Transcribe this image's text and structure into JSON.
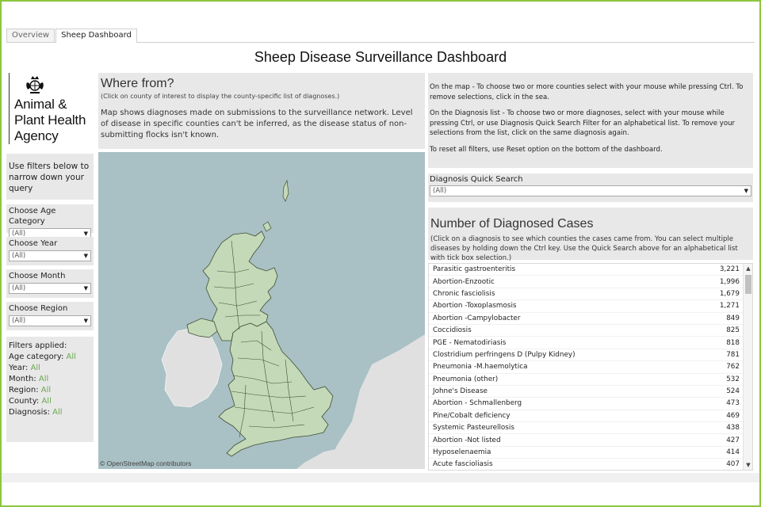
{
  "tabs": [
    {
      "label": "Overview",
      "active": false
    },
    {
      "label": "Sheep Dashboard",
      "active": true
    }
  ],
  "dashboard_title": "Sheep Disease Surveillance Dashboard",
  "agency": {
    "name": "Animal &\nPlant Health\nAgency",
    "crest_icon": "royal-crest-icon"
  },
  "filters_intro": "Use filters below to narrow down your query",
  "filters": [
    {
      "label": "Choose Age Category",
      "value": "(All)"
    },
    {
      "label": "Choose Year",
      "value": "(All)"
    },
    {
      "label": "Choose Month",
      "value": "(All)"
    },
    {
      "label": "Choose Region",
      "value": "(All)"
    }
  ],
  "applied": {
    "heading": "Filters applied:",
    "items": [
      {
        "label": "Age category:",
        "value": "All"
      },
      {
        "label": "Year:",
        "value": "All"
      },
      {
        "label": "Month:",
        "value": "All"
      },
      {
        "label": "Region:",
        "value": "All"
      },
      {
        "label": "County:",
        "value": "All"
      },
      {
        "label": "Diagnosis:",
        "value": "All"
      }
    ]
  },
  "where": {
    "title": "Where from?",
    "subtitle": "(Click on county of interest to display the county-specific list of diagnoses.)",
    "description": "Map shows diagnoses made on submissions to the surveillance network. Level of disease in specific counties can't be inferred, as the disease status of non-submitting flocks isn't known."
  },
  "map": {
    "attribution": "© OpenStreetMap contributors"
  },
  "instructions": [
    "On the map - To choose two or more counties select with your mouse while pressing Ctrl. To remove selections, click in the sea.",
    "On the Diagnosis list - To choose two or more diagnoses, select with your mouse while pressing Ctrl, or use Diagnosis Quick Search Filter for an alphabetical list. To remove your selections from the list, click on the same diagnosis again.",
    "To reset all filters, use Reset option on the bottom of the dashboard."
  ],
  "quick_search": {
    "label": "Diagnosis Quick Search",
    "value": "(All)"
  },
  "cases": {
    "title": "Number of Diagnosed Cases",
    "subtitle": "(Click on a diagnosis to see which counties the cases came from. You can select multiple diseases by holding down the Ctrl key. Use the Quick Search above for an alphabetical list with tick box selection.)",
    "rows": [
      {
        "name": "Parasitic gastroenteritis",
        "count": "3,221"
      },
      {
        "name": "Abortion-Enzootic",
        "count": "1,996"
      },
      {
        "name": "Chronic fasciolisis",
        "count": "1,679"
      },
      {
        "name": "Abortion -Toxoplasmosis",
        "count": "1,271"
      },
      {
        "name": "Abortion -Campylobacter",
        "count": "849"
      },
      {
        "name": "Coccidiosis",
        "count": "825"
      },
      {
        "name": "PGE - Nematodiriasis",
        "count": "818"
      },
      {
        "name": "Clostridium perfringens D (Pulpy Kidney)",
        "count": "781"
      },
      {
        "name": "Pneumonia -M.haemolytica",
        "count": "762"
      },
      {
        "name": "Pneumonia (other)",
        "count": "532"
      },
      {
        "name": "Johne's Disease",
        "count": "524"
      },
      {
        "name": "Abortion - Schmallenberg",
        "count": "473"
      },
      {
        "name": "Pine/Cobalt deficiency",
        "count": "469"
      },
      {
        "name": "Systemic Pasteurellosis",
        "count": "438"
      },
      {
        "name": "Abortion -Not listed",
        "count": "427"
      },
      {
        "name": "Hyposelenaemia",
        "count": "414"
      },
      {
        "name": "Acute fascioliasis",
        "count": "407"
      }
    ]
  },
  "colors": {
    "frame": "#8cc63f",
    "panel": "#e8e8e8",
    "sea": "#a9c0c4",
    "land_other": "#e0e0e0",
    "gb_land": "#c4d9b8",
    "filter_value": "#6aa84f"
  }
}
